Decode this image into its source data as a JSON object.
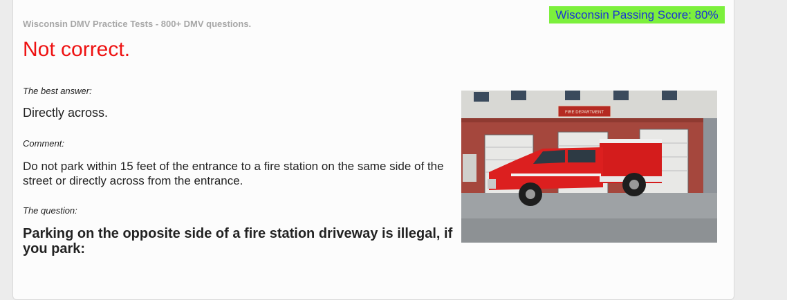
{
  "header": {
    "site_title": "Wisconsin DMV Practice Tests - 800+ DMV questions.",
    "passing_score": "Wisconsin Passing Score: 80%"
  },
  "result": {
    "verdict": "Not correct.",
    "best_answer_label": "The best answer:",
    "best_answer": "Directly across.",
    "comment_label": "Comment:",
    "comment": "Do not park within 15 feet of the entrance to a fire station on the same side of the street or directly across from the entrance.",
    "question_label": "The question:",
    "question": "Parking on the opposite side of a fire station driveway is illegal, if you park:"
  },
  "image": {
    "sign_text": "FIRE DEPARTMENT",
    "colors": {
      "brick": "#a8473c",
      "truck": "#d81e1e",
      "sky": "#c7cfd6"
    }
  }
}
